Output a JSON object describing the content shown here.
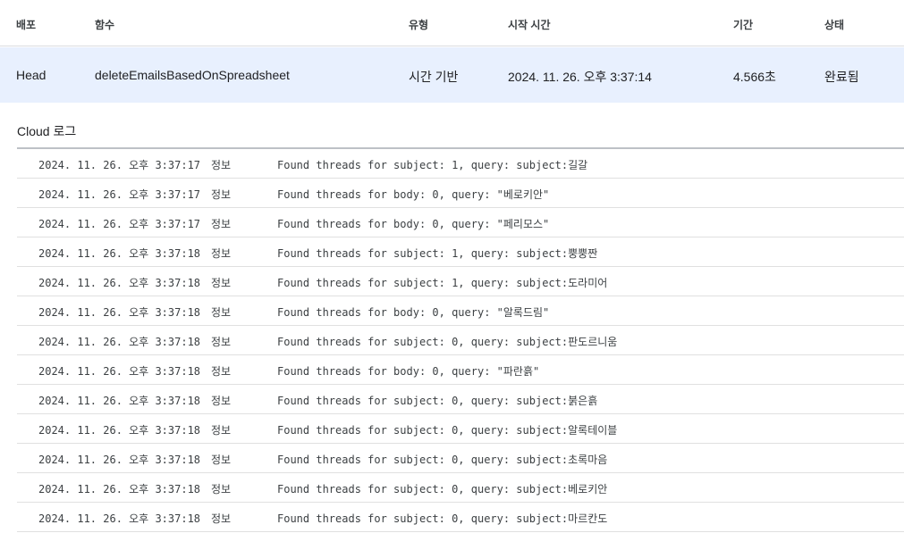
{
  "executions_table": {
    "columns": {
      "deployment": "배포",
      "function": "함수",
      "type": "유형",
      "start_time": "시작 시간",
      "duration": "기간",
      "status": "상태"
    },
    "rows": [
      {
        "deployment": "Head",
        "function": "deleteEmailsBasedOnSpreadsheet",
        "type": "시간 기반",
        "start_time": "2024. 11. 26. 오후 3:37:14",
        "duration": "4.566초",
        "status": "완료됨"
      }
    ]
  },
  "cloud_logs": {
    "title": "Cloud 로그",
    "entries": [
      {
        "time": "2024. 11. 26. 오후 3:37:17",
        "severity": "정보",
        "message": "Found threads for subject: 1, query: subject:길갈"
      },
      {
        "time": "2024. 11. 26. 오후 3:37:17",
        "severity": "정보",
        "message": "Found threads for body: 0, query: \"베로키안\""
      },
      {
        "time": "2024. 11. 26. 오후 3:37:17",
        "severity": "정보",
        "message": "Found threads for body: 0, query: \"페리모스\""
      },
      {
        "time": "2024. 11. 26. 오후 3:37:18",
        "severity": "정보",
        "message": "Found threads for subject: 1, query: subject:뿡뿡짠"
      },
      {
        "time": "2024. 11. 26. 오후 3:37:18",
        "severity": "정보",
        "message": "Found threads for subject: 1, query: subject:도라미어"
      },
      {
        "time": "2024. 11. 26. 오후 3:37:18",
        "severity": "정보",
        "message": "Found threads for body: 0, query: \"알록드림\""
      },
      {
        "time": "2024. 11. 26. 오후 3:37:18",
        "severity": "정보",
        "message": "Found threads for subject: 0, query: subject:판도르니움"
      },
      {
        "time": "2024. 11. 26. 오후 3:37:18",
        "severity": "정보",
        "message": "Found threads for body: 0, query: \"파란흙\""
      },
      {
        "time": "2024. 11. 26. 오후 3:37:18",
        "severity": "정보",
        "message": "Found threads for subject: 0, query: subject:붉은흙"
      },
      {
        "time": "2024. 11. 26. 오후 3:37:18",
        "severity": "정보",
        "message": "Found threads for subject: 0, query: subject:알록테이블"
      },
      {
        "time": "2024. 11. 26. 오후 3:37:18",
        "severity": "정보",
        "message": "Found threads for subject: 0, query: subject:초록마음"
      },
      {
        "time": "2024. 11. 26. 오후 3:37:18",
        "severity": "정보",
        "message": "Found threads for subject: 0, query: subject:베로키안"
      },
      {
        "time": "2024. 11. 26. 오후 3:37:18",
        "severity": "정보",
        "message": "Found threads for subject: 0, query: subject:마르칸도"
      }
    ]
  }
}
